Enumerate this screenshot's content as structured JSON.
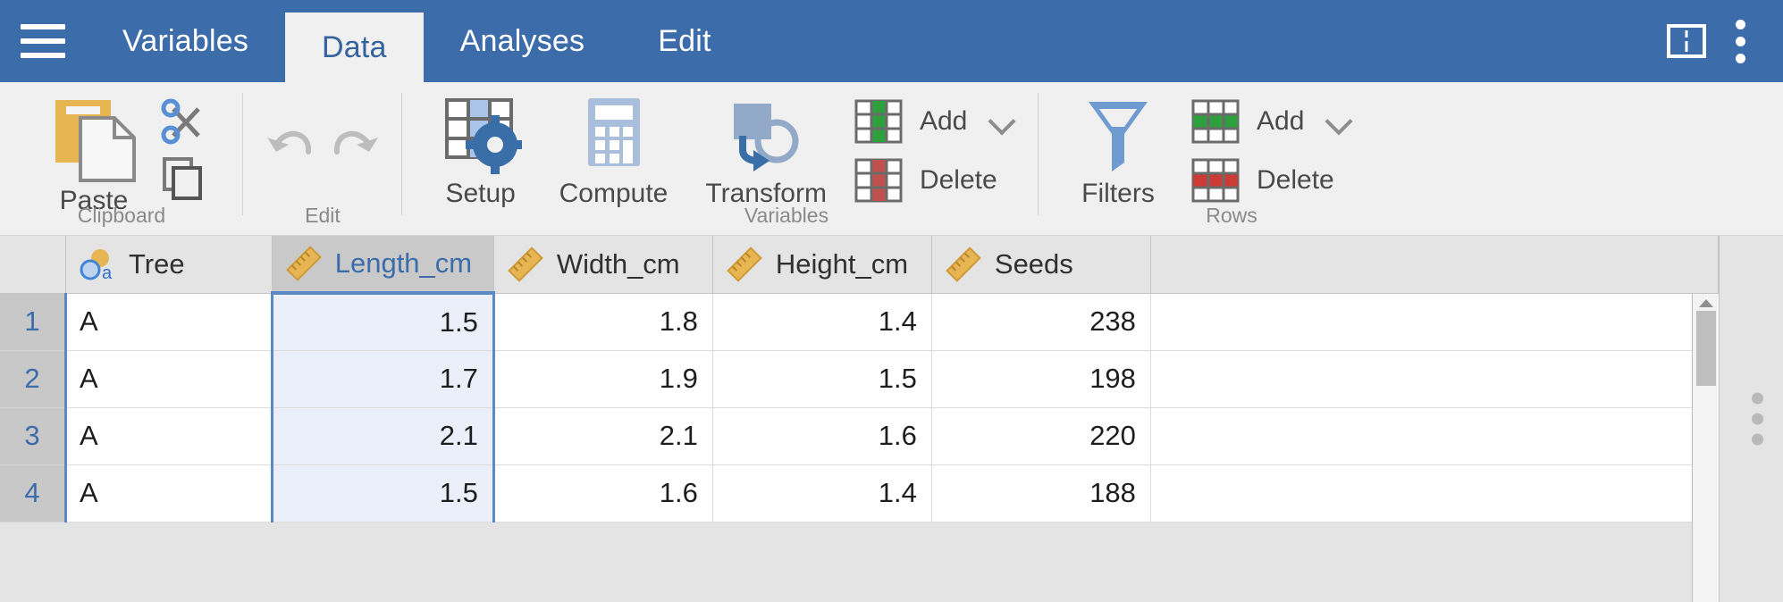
{
  "app": {
    "menu_icon": "hamburger-icon",
    "tabs": [
      {
        "label": "Variables",
        "active": false
      },
      {
        "label": "Data",
        "active": true
      },
      {
        "label": "Analyses",
        "active": false
      },
      {
        "label": "Edit",
        "active": false
      }
    ],
    "right_icons": [
      {
        "name": "split-view-icon"
      },
      {
        "name": "kebab-menu-icon"
      }
    ],
    "accent_blue": "#3d6cab",
    "tab_active_bg": "#f0f0f0",
    "ribbon_bg": "#f0f0f0"
  },
  "ribbon": {
    "groups": [
      {
        "label": "Clipboard",
        "buttons": [
          {
            "name": "paste-button",
            "label": "Paste",
            "icon": "paste-icon"
          },
          {
            "name": "cut-button",
            "label": "",
            "icon": "scissors-icon"
          },
          {
            "name": "copy-button",
            "label": "",
            "icon": "copy-icon"
          }
        ]
      },
      {
        "label": "Edit",
        "buttons": [
          {
            "name": "undo-button",
            "label": "",
            "icon": "undo-arrow-icon",
            "disabled": true
          },
          {
            "name": "redo-button",
            "label": "",
            "icon": "redo-arrow-icon",
            "disabled": true
          }
        ]
      },
      {
        "label": "Variables",
        "buttons": [
          {
            "name": "setup-button",
            "label": "Setup",
            "icon": "grid-gear-icon"
          },
          {
            "name": "compute-button",
            "label": "Compute",
            "icon": "calculator-icon"
          },
          {
            "name": "transform-button",
            "label": "Transform",
            "icon": "transform-icon"
          },
          {
            "name": "variable-add-button",
            "label": "Add",
            "icon": "column-add-green-icon"
          },
          {
            "name": "variable-delete-button",
            "label": "Delete",
            "icon": "column-delete-red-icon"
          }
        ]
      },
      {
        "label": "Rows",
        "buttons": [
          {
            "name": "filters-button",
            "label": "Filters",
            "icon": "funnel-icon"
          },
          {
            "name": "row-add-button",
            "label": "Add",
            "icon": "row-add-green-icon"
          },
          {
            "name": "row-delete-button",
            "label": "Delete",
            "icon": "row-delete-red-icon"
          }
        ]
      }
    ],
    "labels": {
      "paste": "Paste",
      "clipboard": "Clipboard",
      "edit": "Edit",
      "setup": "Setup",
      "compute": "Compute",
      "transform": "Transform",
      "variables": "Variables",
      "var_add": "Add",
      "var_delete": "Delete",
      "filters": "Filters",
      "rows": "Rows",
      "row_add": "Add",
      "row_delete": "Delete"
    }
  },
  "sheet": {
    "selected_column": "Length_cm",
    "columns": [
      {
        "name": "Tree",
        "type_icon": "nominal-text-icon",
        "align": "left",
        "selected": false
      },
      {
        "name": "Length_cm",
        "type_icon": "continuous-ruler-icon",
        "align": "right",
        "selected": true
      },
      {
        "name": "Width_cm",
        "type_icon": "continuous-ruler-icon",
        "align": "right",
        "selected": false
      },
      {
        "name": "Height_cm",
        "type_icon": "continuous-ruler-icon",
        "align": "right",
        "selected": false
      },
      {
        "name": "Seeds",
        "type_icon": "continuous-ruler-icon",
        "align": "right",
        "selected": false
      },
      {
        "name": "",
        "type_icon": "",
        "align": "left",
        "selected": false
      }
    ],
    "rows": [
      {
        "n": "1",
        "cells": [
          "A",
          "1.5",
          "1.8",
          "1.4",
          "238",
          ""
        ]
      },
      {
        "n": "2",
        "cells": [
          "A",
          "1.7",
          "1.9",
          "1.5",
          "198",
          ""
        ]
      },
      {
        "n": "3",
        "cells": [
          "A",
          "2.1",
          "2.1",
          "1.6",
          "220",
          ""
        ]
      },
      {
        "n": "4",
        "cells": [
          "A",
          "1.5",
          "1.6",
          "1.4",
          "188",
          ""
        ]
      }
    ],
    "scrollbar": {
      "name": "vertical-scrollbar",
      "position": "top"
    }
  }
}
